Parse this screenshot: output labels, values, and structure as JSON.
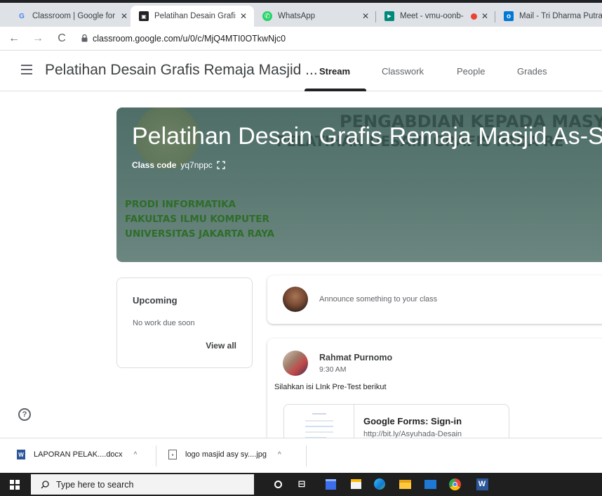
{
  "browser": {
    "tabs": [
      {
        "title": "Classroom | Google for",
        "close": "✕",
        "favicon": "G",
        "color": "#4285f4"
      },
      {
        "title": "Pelatihan Desain Grafis",
        "close": "✕",
        "favicon": "▣",
        "color": "#202124"
      },
      {
        "title": "WhatsApp",
        "close": "✕",
        "favicon": "✆",
        "color": "#25d366"
      },
      {
        "title": "Meet - vmu-oonb-",
        "close": "✕",
        "favicon": "▶",
        "color": "#00897b"
      },
      {
        "title": "Mail - Tri Dharma Putra",
        "close": "",
        "favicon": "o",
        "color": "#0078d4"
      }
    ],
    "url": "classroom.google.com/u/0/c/MjQ4MTI0OTkwNjc0"
  },
  "classroom": {
    "class_name": "Pelatihan Desain Grafis Remaja Masjid ...",
    "nav": {
      "stream": "Stream",
      "classwork": "Classwork",
      "people": "People",
      "grades": "Grades"
    }
  },
  "banner": {
    "title": "Pelatihan Desain Grafis Remaja Masjid As-Sy",
    "class_code_label": "Class code",
    "class_code": "yq7nppc",
    "bg_line1": "PENGABDIAN KEPADA MASY",
    "bg_line2": "PELATIHAN DESAIN GRAFIS PADA RE",
    "lines": [
      "PRODI INFORMATIKA",
      "FAKULTAS ILMU KOMPUTER",
      "UNIVERSITAS JAKARTA RAYA"
    ]
  },
  "upcoming": {
    "title": "Upcoming",
    "subtitle": "No work due soon",
    "link": "View all"
  },
  "announce": {
    "placeholder": "Announce something to your class"
  },
  "post": {
    "author": "Rahmat Purnomo",
    "time": "9:30 AM",
    "body": "Silahkan isi LInk Pre-Test berikut",
    "attachment_title": "Google Forms: Sign-in",
    "attachment_url": "http://bit.ly/Asyuhada-Desain"
  },
  "help": "?",
  "downloads": [
    {
      "name": "LAPORAN PELAK....docx",
      "chevron": "^"
    },
    {
      "name": "logo masjid asy sy....jpg",
      "chevron": "^"
    }
  ],
  "taskbar": {
    "search_placeholder": "Type here to search",
    "icons": [
      "cortana-icon",
      "task-view-icon",
      "calendar-app-icon",
      "store-icon",
      "edge-icon",
      "file-explorer-icon",
      "mail-icon",
      "chrome-icon",
      "word-icon"
    ]
  }
}
